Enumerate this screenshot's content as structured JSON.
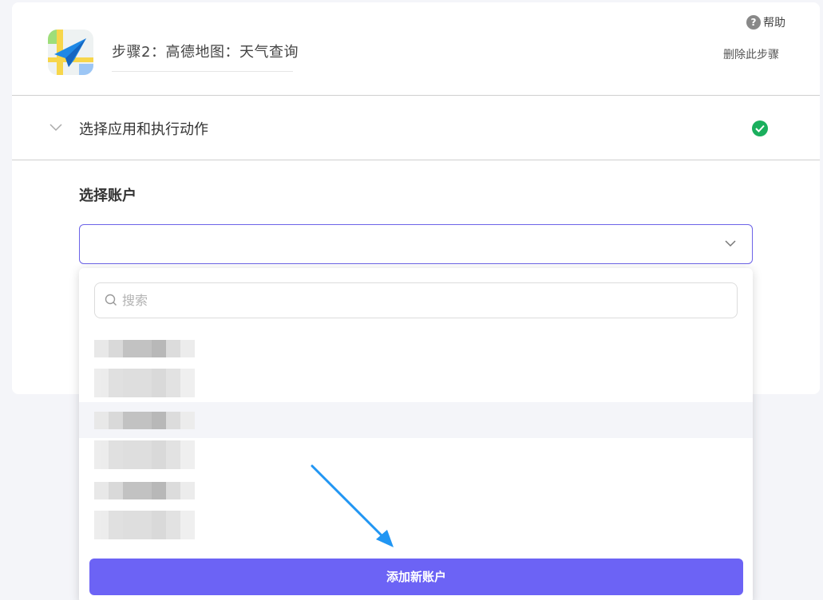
{
  "step": {
    "title": "步骤2：高德地图：天气查询",
    "help_label": "帮助",
    "help_icon_glyph": "?",
    "delete_label": "删除此步骤",
    "app_icon": "amap-icon"
  },
  "section": {
    "label": "选择应用和执行动作",
    "status": "completed",
    "status_color": "#1aaf5d"
  },
  "account": {
    "label": "选择账户",
    "selected_value": "",
    "search_placeholder": "搜索",
    "add_button_label": "添加新账户"
  },
  "colors": {
    "accent": "#6c63f5",
    "select_border": "#6c63e8",
    "annotation_arrow": "#2196f3"
  }
}
